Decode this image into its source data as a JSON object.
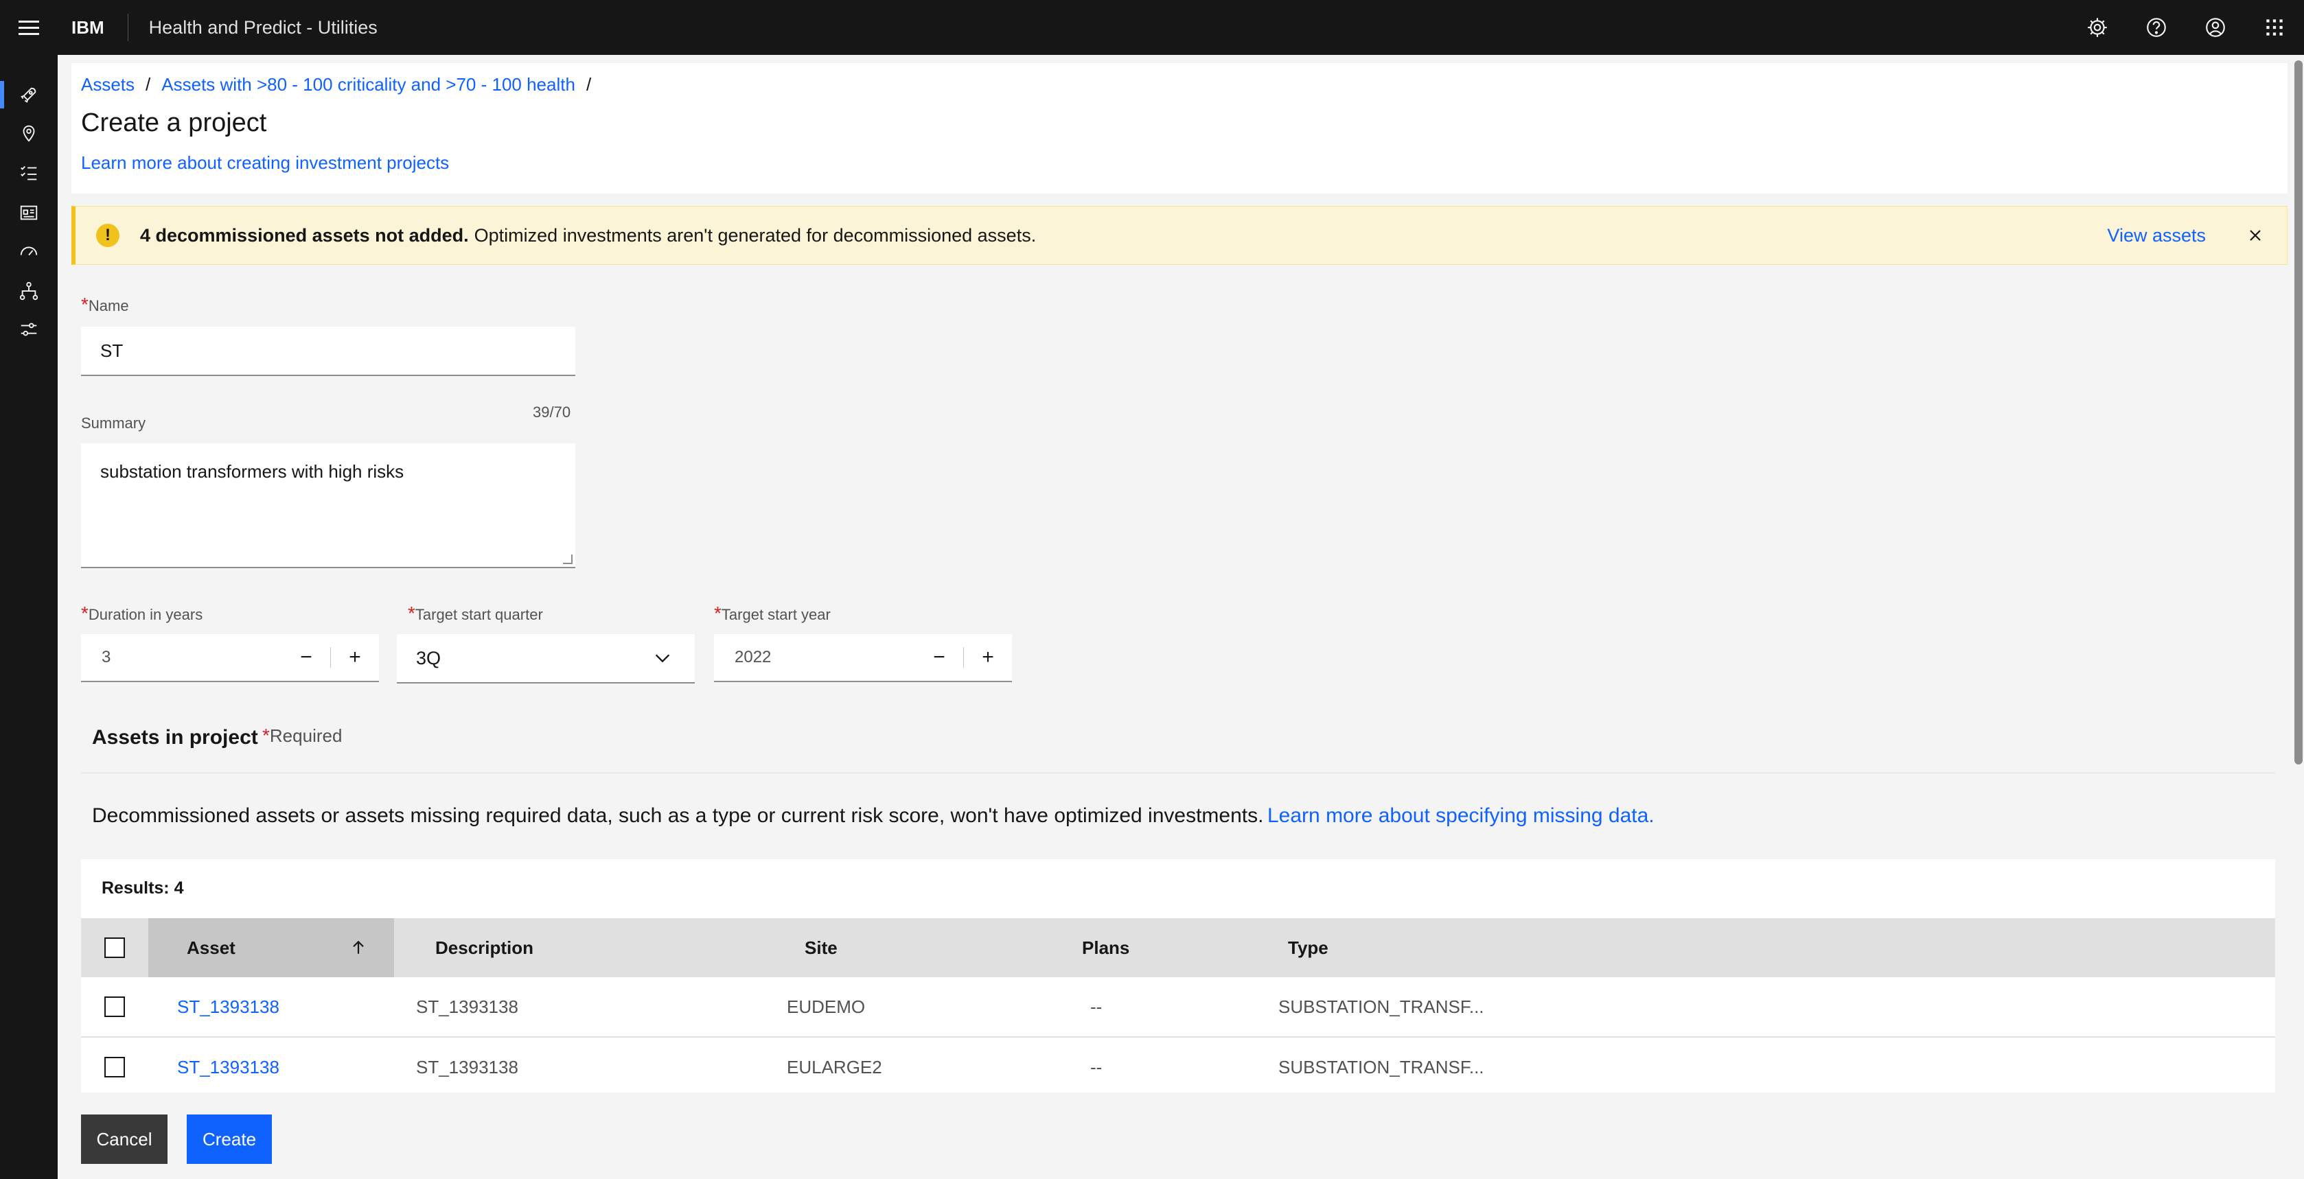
{
  "header": {
    "brand": "IBM",
    "app_title": "Health and Predict - Utilities",
    "icons": [
      "settings-icon",
      "help-icon",
      "user-avatar-icon",
      "app-switcher-icon"
    ]
  },
  "siderail": [
    "rocket-icon",
    "location-icon",
    "task-list-icon",
    "dashboard-icon",
    "meter-icon",
    "hierarchy-icon",
    "settings-adjust-icon"
  ],
  "breadcrumb": {
    "item1": "Assets",
    "item2": "Assets with >80 - 100 criticality and >70 - 100 health",
    "sep": "/"
  },
  "page": {
    "title": "Create a project",
    "learn_link": "Learn more about creating investment projects"
  },
  "notification": {
    "title": "4 decommissioned assets not added.",
    "text": "Optimized investments aren't generated for decommissioned assets.",
    "action": "View assets",
    "accent_color": "#f1c21b"
  },
  "form": {
    "required_mark": "*",
    "name_label": "Name",
    "name_value": "ST",
    "summary_label": "Summary",
    "summary_counter": "39/70",
    "summary_value": "substation transformers with high risks",
    "duration_label": "Duration in years",
    "duration_value": "3",
    "quarter_label": "Target start quarter",
    "quarter_value": "3Q",
    "year_label": "Target start year",
    "year_value": "2022",
    "minus": "−",
    "plus": "+"
  },
  "assets": {
    "title": "Assets in project",
    "required_text": "Required",
    "info": "Decommissioned assets or assets missing required data, such as a type or current risk score, won't have optimized investments.",
    "info_link": "Learn more about specifying missing data.",
    "results": "Results: 4",
    "columns": {
      "asset": "Asset",
      "description": "Description",
      "site": "Site",
      "plans": "Plans",
      "type": "Type"
    },
    "rows": [
      {
        "asset": "ST_1393138",
        "description": "ST_1393138",
        "site": "EUDEMO",
        "plans": "--",
        "type": "SUBSTATION_TRANSF..."
      },
      {
        "asset": "ST_1393138",
        "description": "ST_1393138",
        "site": "EULARGE2",
        "plans": "--",
        "type": "SUBSTATION_TRANSF..."
      }
    ]
  },
  "footer": {
    "cancel": "Cancel",
    "create": "Create",
    "primary_color": "#0f62fe"
  }
}
